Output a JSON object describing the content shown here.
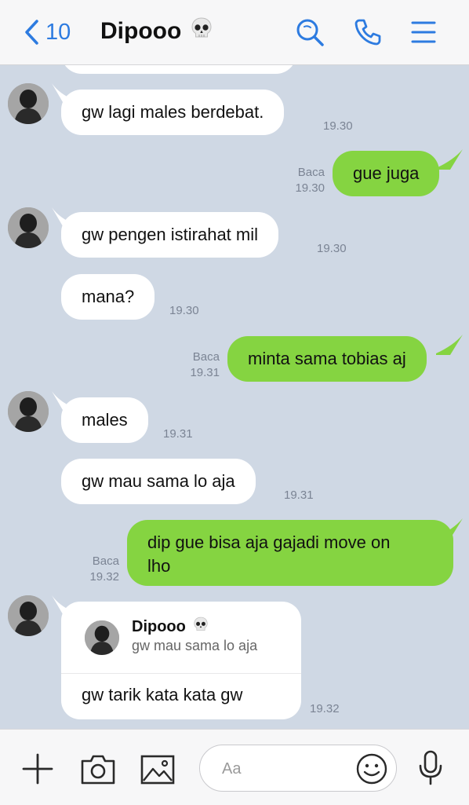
{
  "header": {
    "back_count": "10",
    "title": "Dipooo",
    "title_emoji": "skull"
  },
  "messages": [
    {
      "dir": "in",
      "text": "gw lagi males berdebat.",
      "time": "19.30",
      "avatar": true
    },
    {
      "dir": "out",
      "text": "gue juga",
      "read": "Baca",
      "time": "19.30"
    },
    {
      "dir": "in",
      "text": "gw pengen istirahat mil",
      "time": "19.30",
      "avatar": true
    },
    {
      "dir": "in",
      "text": "mana?",
      "time": "19.30"
    },
    {
      "dir": "out",
      "text": "minta sama tobias aj",
      "read": "Baca",
      "time": "19.31"
    },
    {
      "dir": "in",
      "text": "males",
      "time": "19.31",
      "avatar": true
    },
    {
      "dir": "in",
      "text": "gw mau sama lo aja",
      "time": "19.31"
    },
    {
      "dir": "out",
      "text_line1": "dip gue bisa aja gajadi move on",
      "text_line2": "lho",
      "read": "Baca",
      "time": "19.32"
    },
    {
      "dir": "in",
      "quote_name": "Dipooo",
      "quote_text": "gw mau sama lo aja",
      "text": "gw tarik kata kata gw",
      "time": "19.32",
      "avatar": true
    }
  ],
  "input": {
    "placeholder": "Aa"
  },
  "colors": {
    "background": "#cfd8e4",
    "outgoing_bubble": "#85d441",
    "incoming_bubble": "#ffffff",
    "accent": "#2d7be0"
  }
}
